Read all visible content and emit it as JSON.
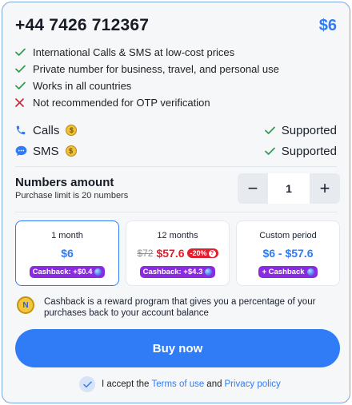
{
  "header": {
    "phone": "+44 7426 712367",
    "price": "$6"
  },
  "features": [
    {
      "icon": "check-icon",
      "text": "International Calls & SMS at low-cost prices"
    },
    {
      "icon": "check-icon",
      "text": "Private number for business, travel, and personal use"
    },
    {
      "icon": "check-icon",
      "text": "Works in all countries"
    },
    {
      "icon": "cross-icon",
      "text": "Not recommended for OTP verification"
    }
  ],
  "services": {
    "calls": {
      "label": "Calls",
      "status": "Supported",
      "coin": "$"
    },
    "sms": {
      "label": "SMS",
      "status": "Supported",
      "coin": "$"
    }
  },
  "amount": {
    "title": "Numbers amount",
    "subtitle": "Purchase limit is 20 numbers",
    "minus": "−",
    "value": "1",
    "plus": "+"
  },
  "plans": {
    "month1": {
      "title": "1 month",
      "price": "$6",
      "cashback": "Cashback: +$0.4"
    },
    "months12": {
      "title": "12 months",
      "old_price": "$72",
      "price": "$57.6",
      "discount": "-20%",
      "cashback": "Cashback: +$4.3"
    },
    "custom": {
      "title": "Custom period",
      "price": "$6 - $57.6",
      "cashback": "+ Cashback"
    }
  },
  "cashback_info": {
    "coin_letter": "N",
    "text": "Cashback is a reward program that gives you a percentage of your purchases back to your account balance"
  },
  "buy_button": "Buy now",
  "accept": {
    "prefix": "I accept the",
    "terms": "Terms of use",
    "and": "and",
    "privacy": "Privacy policy"
  },
  "colors": {
    "accent": "#2f7cf6",
    "danger": "#e0202e",
    "success": "#2e9b4e",
    "cashback": "#8a2be2"
  }
}
